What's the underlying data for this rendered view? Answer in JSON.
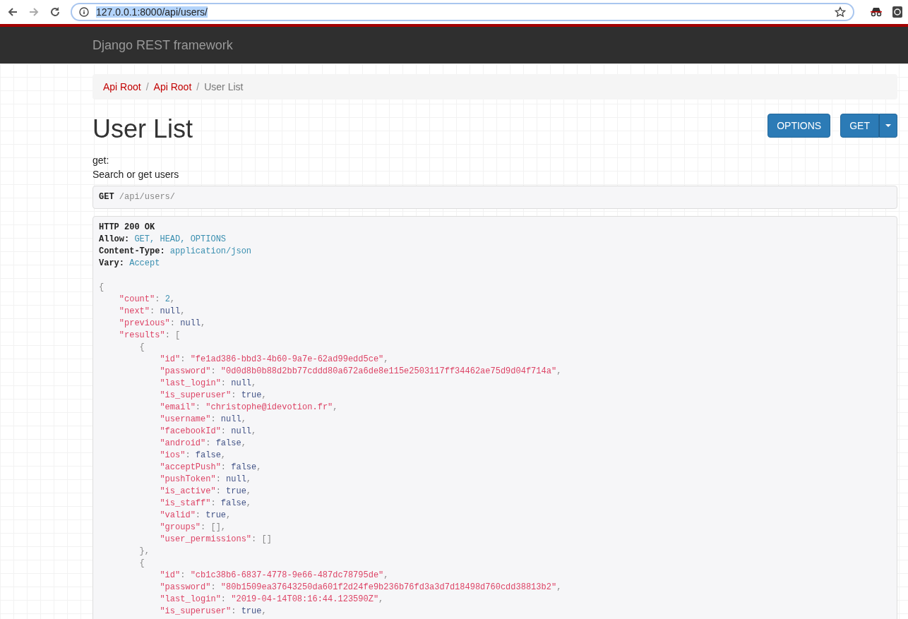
{
  "browser": {
    "url": "127.0.0.1:8000/api/users/"
  },
  "navbar": {
    "brand": "Django REST framework"
  },
  "breadcrumb_separator": "/",
  "breadcrumbs": [
    {
      "label": "Api Root",
      "active": false
    },
    {
      "label": "Api Root",
      "active": false
    },
    {
      "label": "User List",
      "active": true
    }
  ],
  "title": "User List",
  "buttons": [
    {
      "label": "OPTIONS",
      "kind": "plain"
    },
    {
      "label": "GET",
      "kind": "split"
    }
  ],
  "description": {
    "method": "get:",
    "text": "Search or get users"
  },
  "request": {
    "method": "GET",
    "path": "/api/users/"
  },
  "response": {
    "status": "HTTP 200 OK",
    "headers": [
      {
        "name": "Allow:",
        "value": "GET, HEAD, OPTIONS"
      },
      {
        "name": "Content-Type:",
        "value": "application/json"
      },
      {
        "name": "Vary:",
        "value": "Accept"
      }
    ],
    "body": {
      "open": [
        {
          "kind": "pun",
          "text": "{"
        }
      ],
      "children": [
        {
          "line": [
            {
              "kind": "key",
              "text": "\"count\""
            },
            {
              "kind": "pun",
              "text": ": "
            },
            {
              "kind": "num",
              "text": "2"
            },
            {
              "kind": "pun",
              "text": ","
            }
          ]
        },
        {
          "line": [
            {
              "kind": "key",
              "text": "\"next\""
            },
            {
              "kind": "pun",
              "text": ": "
            },
            {
              "kind": "lit",
              "text": "null"
            },
            {
              "kind": "pun",
              "text": ","
            }
          ]
        },
        {
          "line": [
            {
              "kind": "key",
              "text": "\"previous\""
            },
            {
              "kind": "pun",
              "text": ": "
            },
            {
              "kind": "lit",
              "text": "null"
            },
            {
              "kind": "pun",
              "text": ","
            }
          ]
        },
        {
          "open": [
            {
              "kind": "key",
              "text": "\"results\""
            },
            {
              "kind": "pun",
              "text": ": ["
            }
          ],
          "children": [
            {
              "open": [
                {
                  "kind": "pun",
                  "text": "{"
                }
              ],
              "children": [
                {
                  "line": [
                    {
                      "kind": "key",
                      "text": "\"id\""
                    },
                    {
                      "kind": "pun",
                      "text": ": "
                    },
                    {
                      "kind": "str",
                      "text": "\"fe1ad386-bbd3-4b60-9a7e-62ad99edd5ce\""
                    },
                    {
                      "kind": "pun",
                      "text": ","
                    }
                  ]
                },
                {
                  "line": [
                    {
                      "kind": "key",
                      "text": "\"password\""
                    },
                    {
                      "kind": "pun",
                      "text": ": "
                    },
                    {
                      "kind": "str",
                      "text": "\"0d0d8b0b88d2bb77cddd80a672a6de8e115e2503117ff34462ae75d9d04f714a\""
                    },
                    {
                      "kind": "pun",
                      "text": ","
                    }
                  ]
                },
                {
                  "line": [
                    {
                      "kind": "key",
                      "text": "\"last_login\""
                    },
                    {
                      "kind": "pun",
                      "text": ": "
                    },
                    {
                      "kind": "lit",
                      "text": "null"
                    },
                    {
                      "kind": "pun",
                      "text": ","
                    }
                  ]
                },
                {
                  "line": [
                    {
                      "kind": "key",
                      "text": "\"is_superuser\""
                    },
                    {
                      "kind": "pun",
                      "text": ": "
                    },
                    {
                      "kind": "lit",
                      "text": "true"
                    },
                    {
                      "kind": "pun",
                      "text": ","
                    }
                  ]
                },
                {
                  "line": [
                    {
                      "kind": "key",
                      "text": "\"email\""
                    },
                    {
                      "kind": "pun",
                      "text": ": "
                    },
                    {
                      "kind": "str",
                      "text": "\"christophe@idevotion.fr\""
                    },
                    {
                      "kind": "pun",
                      "text": ","
                    }
                  ]
                },
                {
                  "line": [
                    {
                      "kind": "key",
                      "text": "\"username\""
                    },
                    {
                      "kind": "pun",
                      "text": ": "
                    },
                    {
                      "kind": "lit",
                      "text": "null"
                    },
                    {
                      "kind": "pun",
                      "text": ","
                    }
                  ]
                },
                {
                  "line": [
                    {
                      "kind": "key",
                      "text": "\"facebookId\""
                    },
                    {
                      "kind": "pun",
                      "text": ": "
                    },
                    {
                      "kind": "lit",
                      "text": "null"
                    },
                    {
                      "kind": "pun",
                      "text": ","
                    }
                  ]
                },
                {
                  "line": [
                    {
                      "kind": "key",
                      "text": "\"android\""
                    },
                    {
                      "kind": "pun",
                      "text": ": "
                    },
                    {
                      "kind": "lit",
                      "text": "false"
                    },
                    {
                      "kind": "pun",
                      "text": ","
                    }
                  ]
                },
                {
                  "line": [
                    {
                      "kind": "key",
                      "text": "\"ios\""
                    },
                    {
                      "kind": "pun",
                      "text": ": "
                    },
                    {
                      "kind": "lit",
                      "text": "false"
                    },
                    {
                      "kind": "pun",
                      "text": ","
                    }
                  ]
                },
                {
                  "line": [
                    {
                      "kind": "key",
                      "text": "\"acceptPush\""
                    },
                    {
                      "kind": "pun",
                      "text": ": "
                    },
                    {
                      "kind": "lit",
                      "text": "false"
                    },
                    {
                      "kind": "pun",
                      "text": ","
                    }
                  ]
                },
                {
                  "line": [
                    {
                      "kind": "key",
                      "text": "\"pushToken\""
                    },
                    {
                      "kind": "pun",
                      "text": ": "
                    },
                    {
                      "kind": "lit",
                      "text": "null"
                    },
                    {
                      "kind": "pun",
                      "text": ","
                    }
                  ]
                },
                {
                  "line": [
                    {
                      "kind": "key",
                      "text": "\"is_active\""
                    },
                    {
                      "kind": "pun",
                      "text": ": "
                    },
                    {
                      "kind": "lit",
                      "text": "true"
                    },
                    {
                      "kind": "pun",
                      "text": ","
                    }
                  ]
                },
                {
                  "line": [
                    {
                      "kind": "key",
                      "text": "\"is_staff\""
                    },
                    {
                      "kind": "pun",
                      "text": ": "
                    },
                    {
                      "kind": "lit",
                      "text": "false"
                    },
                    {
                      "kind": "pun",
                      "text": ","
                    }
                  ]
                },
                {
                  "line": [
                    {
                      "kind": "key",
                      "text": "\"valid\""
                    },
                    {
                      "kind": "pun",
                      "text": ": "
                    },
                    {
                      "kind": "lit",
                      "text": "true"
                    },
                    {
                      "kind": "pun",
                      "text": ","
                    }
                  ]
                },
                {
                  "line": [
                    {
                      "kind": "key",
                      "text": "\"groups\""
                    },
                    {
                      "kind": "pun",
                      "text": ": "
                    },
                    {
                      "kind": "pun",
                      "text": "[],"
                    }
                  ]
                },
                {
                  "line": [
                    {
                      "kind": "key",
                      "text": "\"user_permissions\""
                    },
                    {
                      "kind": "pun",
                      "text": ": "
                    },
                    {
                      "kind": "pun",
                      "text": "[]"
                    }
                  ]
                }
              ],
              "close": [
                {
                  "kind": "pun",
                  "text": "},"
                }
              ]
            },
            {
              "open": [
                {
                  "kind": "pun",
                  "text": "{"
                }
              ],
              "children": [
                {
                  "line": [
                    {
                      "kind": "key",
                      "text": "\"id\""
                    },
                    {
                      "kind": "pun",
                      "text": ": "
                    },
                    {
                      "kind": "str",
                      "text": "\"cb1c38b6-6837-4778-9e66-487dc78795de\""
                    },
                    {
                      "kind": "pun",
                      "text": ","
                    }
                  ]
                },
                {
                  "line": [
                    {
                      "kind": "key",
                      "text": "\"password\""
                    },
                    {
                      "kind": "pun",
                      "text": ": "
                    },
                    {
                      "kind": "str",
                      "text": "\"80b1509ea37643250da601f2d24fe9b236b76fd3a3d7d18498d760cdd38813b2\""
                    },
                    {
                      "kind": "pun",
                      "text": ","
                    }
                  ]
                },
                {
                  "line": [
                    {
                      "kind": "key",
                      "text": "\"last_login\""
                    },
                    {
                      "kind": "pun",
                      "text": ": "
                    },
                    {
                      "kind": "str",
                      "text": "\"2019-04-14T08:16:44.123590Z\""
                    },
                    {
                      "kind": "pun",
                      "text": ","
                    }
                  ]
                },
                {
                  "line": [
                    {
                      "kind": "key",
                      "text": "\"is_superuser\""
                    },
                    {
                      "kind": "pun",
                      "text": ": "
                    },
                    {
                      "kind": "lit",
                      "text": "true"
                    },
                    {
                      "kind": "pun",
                      "text": ","
                    }
                  ]
                }
              ]
            }
          ]
        }
      ]
    }
  }
}
